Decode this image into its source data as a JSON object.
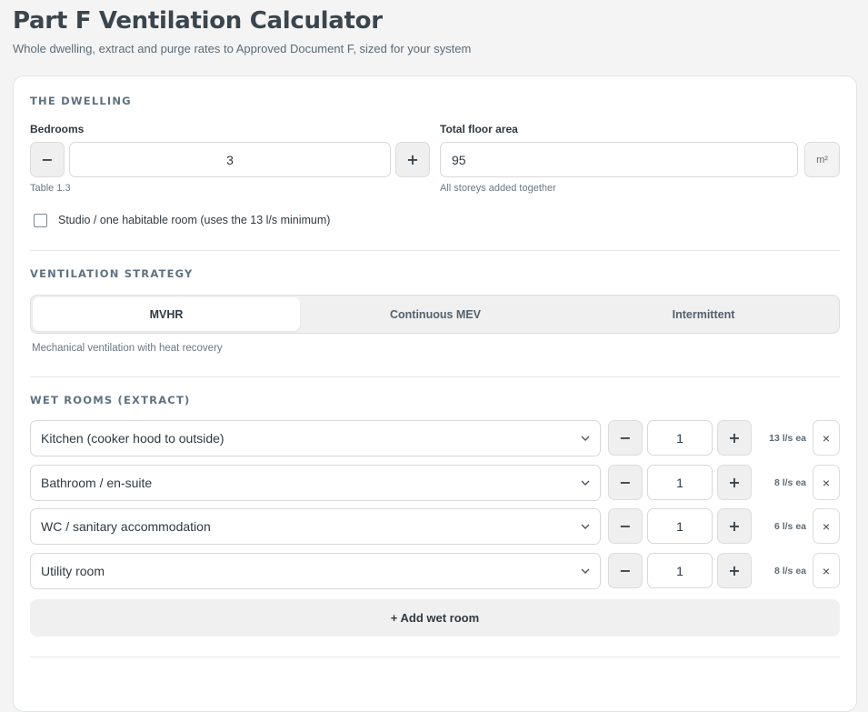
{
  "header": {
    "title": "Part F Ventilation Calculator",
    "subtitle": "Whole dwelling, extract and purge rates to Approved Document F, sized for your system"
  },
  "dwelling": {
    "section_title": "THE DWELLING",
    "bedrooms_label": "Bedrooms",
    "bedrooms_value": "3",
    "bedrooms_hint": "Table 1.3",
    "minus": "−",
    "plus": "+",
    "floor_area_label": "Total floor area",
    "floor_area_value": "95",
    "floor_area_unit": "m²",
    "floor_area_hint": "All storeys added together",
    "studio_label": "Studio / one habitable room (uses the 13 l/s minimum)",
    "studio_checked": false
  },
  "strategy": {
    "section_title": "VENTILATION STRATEGY",
    "options": [
      "MVHR",
      "Continuous MEV",
      "Intermittent"
    ],
    "selected": "MVHR",
    "description": "Mechanical ventilation with heat recovery"
  },
  "wet_rooms": {
    "section_title": "WET ROOMS (EXTRACT)",
    "rooms": [
      {
        "name": "Kitchen (cooker hood to outside)",
        "qty": "1",
        "rate": "13 l/s ea"
      },
      {
        "name": "Bathroom / en-suite",
        "qty": "1",
        "rate": "8 l/s ea"
      },
      {
        "name": "WC / sanitary accommodation",
        "qty": "1",
        "rate": "6 l/s ea"
      },
      {
        "name": "Utility room",
        "qty": "1",
        "rate": "8 l/s ea"
      }
    ],
    "remove_symbol": "×",
    "add_label": "+ Add wet room"
  }
}
